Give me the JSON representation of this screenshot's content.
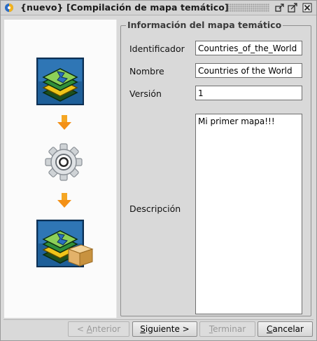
{
  "window": {
    "title": "{nuevo} [Compilación de mapa temático]",
    "controls": [
      "restore-icon",
      "maximize-icon",
      "close-icon"
    ]
  },
  "workflow": {
    "steps": [
      "layers-map-icon",
      "arrow-down-icon",
      "gear-icon",
      "arrow-down-icon",
      "map-package-icon"
    ]
  },
  "form": {
    "legend": "Información del mapa temático",
    "fields": {
      "identificador": {
        "label": "Identificador",
        "value": "Countries_of_the_World"
      },
      "nombre": {
        "label": "Nombre",
        "value": "Countries of the World"
      },
      "version": {
        "label": "Versión",
        "value": "1"
      },
      "descripcion": {
        "label": "Descripción",
        "value": "Mi primer mapa!!!"
      }
    }
  },
  "buttons": {
    "anterior": {
      "prefix": "< ",
      "mnemonic": "A",
      "rest": "nterior",
      "enabled": false
    },
    "siguiente": {
      "mnemonic": "S",
      "rest": "iguiente >",
      "enabled": true
    },
    "terminar": {
      "mnemonic": "T",
      "rest": "erminar",
      "enabled": false
    },
    "cancelar": {
      "mnemonic": "C",
      "rest": "ancelar",
      "enabled": true
    }
  },
  "colors": {
    "accent_orange": "#f5a623",
    "map_blue": "#1e5f99",
    "window_bg": "#d9d9d9"
  }
}
